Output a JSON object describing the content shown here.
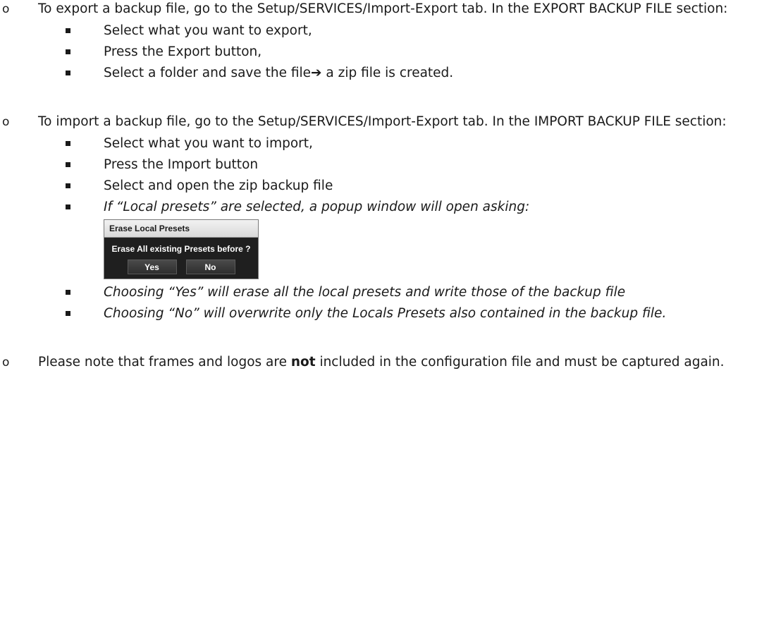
{
  "sections": {
    "export": {
      "bullet": "o",
      "intro": "To export a backup file, go to the Setup/SERVICES/Import-Export tab. In the EXPORT BACKUP FILE section:",
      "steps": [
        "Select what you want to export,",
        "Press the Export button,",
        "Select a folder and save the file➔ a zip file is created."
      ]
    },
    "import": {
      "bullet": "o",
      "intro": "To import a backup file, go to the Setup/SERVICES/Import-Export tab. In the IMPORT BACKUP FILE section:",
      "steps": [
        "Select what you want to import,",
        "Press the Import button",
        "Select and open the zip backup file"
      ],
      "popup_step": "If “Local presets” are selected, a popup window will open asking:",
      "after_steps": [
        "Choosing “Yes” will erase all the local presets and write those of the backup file",
        "Choosing “No” will overwrite only the Locals Presets also contained in the backup file."
      ]
    },
    "note": {
      "bullet": "o",
      "before": "Please note that frames and logos are ",
      "emphasis": "not",
      "after": " included in the configuration file and must be captured again."
    }
  },
  "dialog": {
    "title": "Erase Local Presets",
    "message": "Erase All existing Presets before ?",
    "yes_label": "Yes",
    "no_label": "No"
  }
}
